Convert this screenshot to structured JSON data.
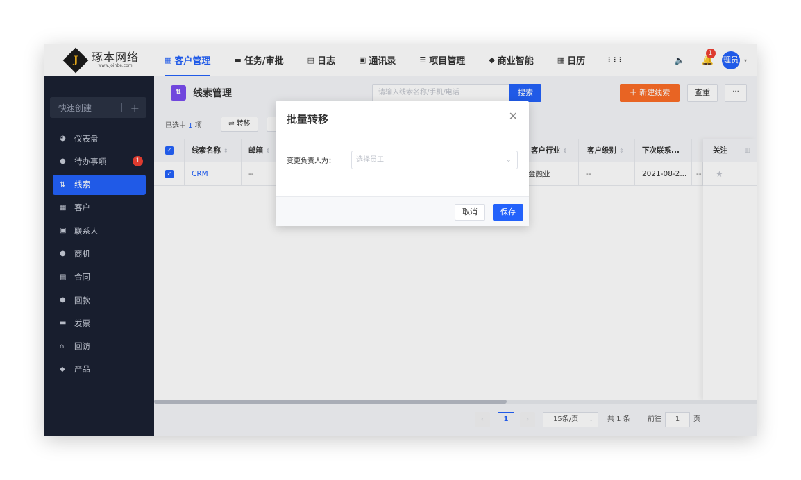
{
  "brand": {
    "name": "琢本网络",
    "url": "www.Joinbe.com",
    "mark": "J"
  },
  "topnav": {
    "items": [
      {
        "label": "客户管理",
        "icon": "building-icon",
        "glyph": "▦"
      },
      {
        "label": "任务/审批",
        "icon": "briefcase-icon",
        "glyph": "▬"
      },
      {
        "label": "日志",
        "icon": "notebook-icon",
        "glyph": "▤"
      },
      {
        "label": "通讯录",
        "icon": "phone-book-icon",
        "glyph": "▣"
      },
      {
        "label": "项目管理",
        "icon": "list-icon",
        "glyph": "☰"
      },
      {
        "label": "商业智能",
        "icon": "shield-check-icon",
        "glyph": "◆"
      },
      {
        "label": "日历",
        "icon": "calendar-icon",
        "glyph": "▦"
      }
    ],
    "apps_glyph": "⋮⋮⋮",
    "speaker_glyph": "🔈",
    "bell_glyph": "🔔",
    "bell_count": "1",
    "avatar_text": "理员",
    "caret": "▾"
  },
  "sidebar": {
    "quick_create": "快速创建",
    "quick_plus": "+",
    "items": [
      {
        "label": "仪表盘",
        "icon": "dashboard-icon",
        "glyph": "◕"
      },
      {
        "label": "待办事项",
        "icon": "chat-bubble-icon",
        "glyph": "●",
        "badge": "1"
      },
      {
        "label": "线索",
        "icon": "leads-icon",
        "glyph": "⇅"
      },
      {
        "label": "客户",
        "icon": "building-icon",
        "glyph": "▦"
      },
      {
        "label": "联系人",
        "icon": "contact-card-icon",
        "glyph": "▣"
      },
      {
        "label": "商机",
        "icon": "coin-icon",
        "glyph": "●"
      },
      {
        "label": "合同",
        "icon": "contract-icon",
        "glyph": "▤"
      },
      {
        "label": "回款",
        "icon": "money-bag-icon",
        "glyph": "●"
      },
      {
        "label": "发票",
        "icon": "invoice-icon",
        "glyph": "▬"
      },
      {
        "label": "回访",
        "icon": "home-icon",
        "glyph": "⌂"
      },
      {
        "label": "产品",
        "icon": "box-icon",
        "glyph": "◆"
      }
    ]
  },
  "page": {
    "icon_glyph": "⇅",
    "title": "线索管理",
    "search_placeholder": "请输入线索名称/手机/电话",
    "search_btn": "搜索",
    "new_btn": "＋ 新建线索",
    "dup_btn": "查重",
    "more_btn": "···"
  },
  "selection": {
    "prefix": "已选中",
    "count": "1",
    "suffix": "项",
    "transfer_btn": "⇌ 转移"
  },
  "table": {
    "sort_glyph": "⇕",
    "check_glyph": "✓",
    "headers": {
      "name": "线索名称",
      "email": "邮箱",
      "industry": "客户行业",
      "level": "客户级别",
      "next_contact": "下次联系...",
      "follow": "关注"
    },
    "row": {
      "name": "CRM",
      "email": "--",
      "industry": "金融业",
      "level": "--",
      "next_contact": "2021-08-2...",
      "extra": "--",
      "star": "★"
    }
  },
  "pagination": {
    "prev": "‹",
    "current": "1",
    "next": "›",
    "page_size": "15条/页",
    "dd": "⌄",
    "total": "共 1 条",
    "goto": "前往",
    "goto_value": "1",
    "page_unit": "页"
  },
  "dialog": {
    "title": "批量转移",
    "close": "✕",
    "label": "变更负责人为：",
    "select_placeholder": "选择员工",
    "chevron": "⌄",
    "cancel": "取消",
    "save": "保存"
  }
}
